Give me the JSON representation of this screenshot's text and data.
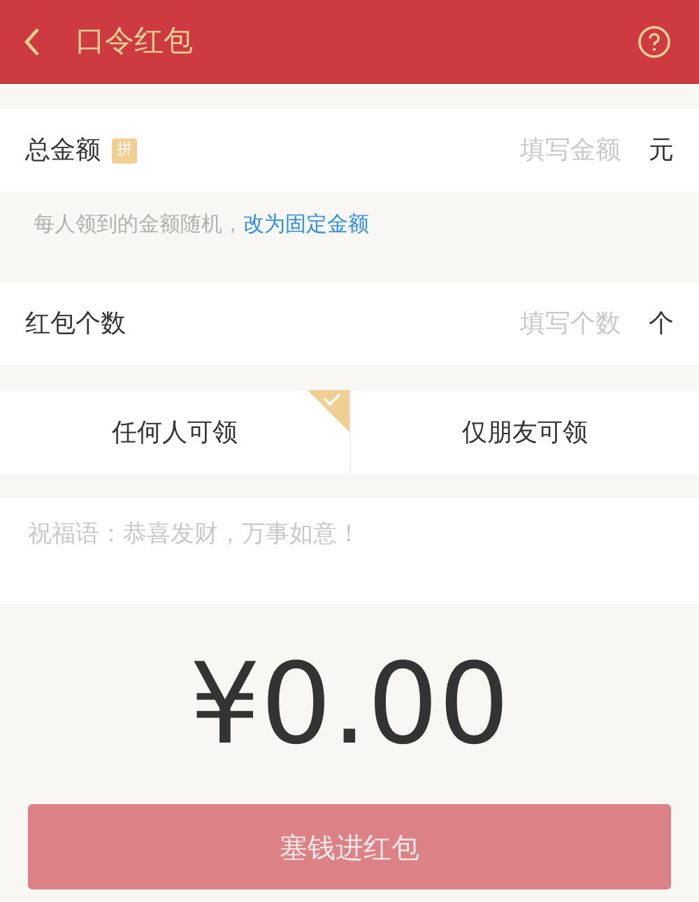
{
  "header": {
    "title": "口令红包"
  },
  "amount_field": {
    "label": "总金额",
    "badge": "拼",
    "placeholder": "填写金额",
    "unit": "元"
  },
  "hint": {
    "text": "每人领到的金额随机，",
    "link": "改为固定金额"
  },
  "count_field": {
    "label": "红包个数",
    "placeholder": "填写个数",
    "unit": "个"
  },
  "tabs": [
    {
      "label": "任何人可领",
      "selected": true
    },
    {
      "label": "仅朋友可领",
      "selected": false
    }
  ],
  "greeting": {
    "placeholder": "祝福语：恭喜发财，万事如意！"
  },
  "total": {
    "symbol": "¥",
    "value": "0.00"
  },
  "submit": {
    "label": "塞钱进红包",
    "disabled": true
  }
}
